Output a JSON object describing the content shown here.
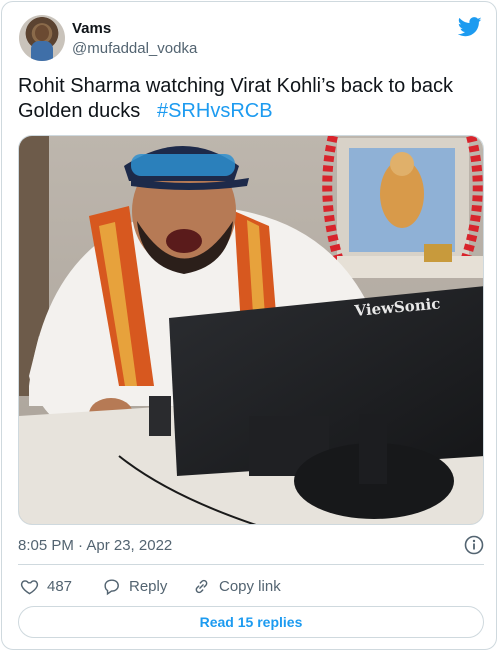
{
  "author": {
    "name": "Vams",
    "handle": "@mufaddal_vodka",
    "avatar_icon": "avatar-photo"
  },
  "tweet": {
    "text": "Rohit Sharma watching Virat Kohli’s back to back Golden ducks",
    "hashtag": "#SRHvsRCB",
    "timestamp": "8:05 PM · Apr 23, 2022"
  },
  "media": {
    "monitor_brand": "ViewSonic"
  },
  "actions": {
    "like_count": "487",
    "reply_label": "Reply",
    "copy_label": "Copy link"
  },
  "footer": {
    "read_replies_label": "Read 15 replies"
  },
  "colors": {
    "accent": "#1d9bf0",
    "secondary_text": "#536471",
    "border": "#cfd9de"
  },
  "icons": {
    "brand": "twitter-bird-icon",
    "info": "info-icon",
    "like": "heart-icon",
    "reply": "speech-bubble-icon",
    "copy": "link-icon"
  }
}
